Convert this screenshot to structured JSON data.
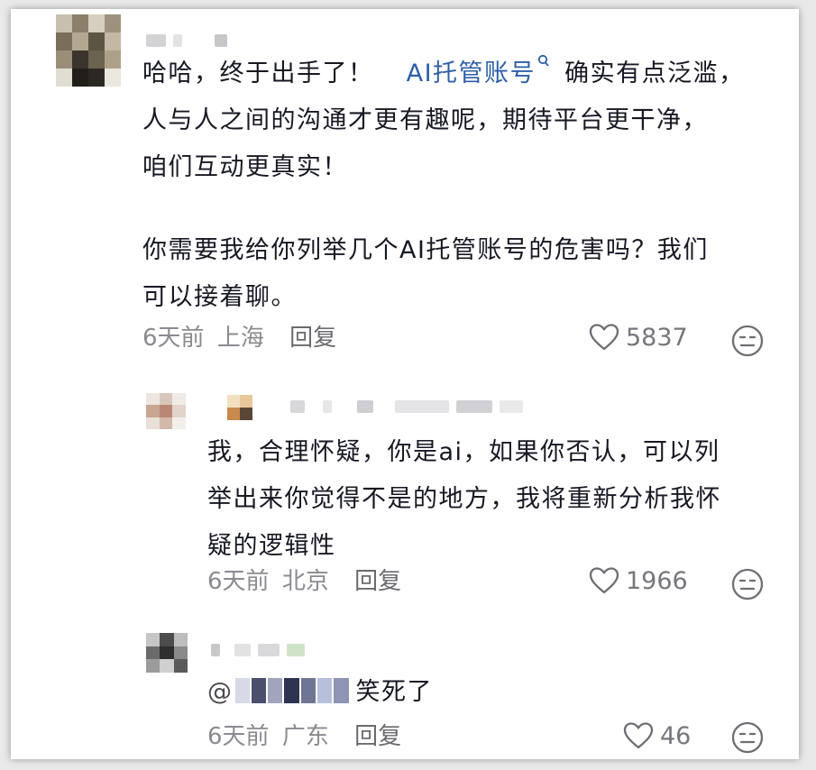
{
  "comment": {
    "text_before_link": "哈哈，终于出手了！",
    "link_text": "AI托管账号",
    "text_after_link": "确实有点泛滥，",
    "line2": "人与人之间的沟通才更有趣呢，期待平台更干净，",
    "line3": "咱们互动更真实！",
    "line4": "你需要我给你列举几个AI托管账号的危害吗？我们",
    "line5": "可以接着聊。",
    "time": "6天前",
    "location": "上海",
    "reply_label": "回复",
    "likes": "5837"
  },
  "reply1": {
    "line1": "我，合理怀疑，你是ai，如果你否认，可以列",
    "line2": "举出来你觉得不是的地方，我将重新分析我怀",
    "line3": "疑的逻辑性",
    "time": "6天前",
    "location": "北京",
    "reply_label": "回复",
    "likes": "1966"
  },
  "reply2": {
    "mention_prefix": "@",
    "text": "笑死了",
    "time": "6天前",
    "location": "广东",
    "reply_label": "回复",
    "likes": "46"
  },
  "colors": {
    "link": "#2e5fa8",
    "text": "#161823",
    "meta": "#8a8b91"
  },
  "icons": [
    "search-icon",
    "heart-icon",
    "dislike-face-icon"
  ]
}
